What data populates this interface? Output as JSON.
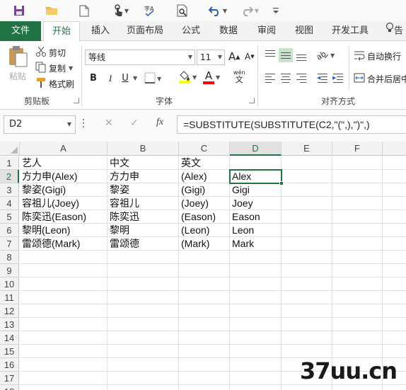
{
  "qat": {
    "icons": [
      "save-icon",
      "open-folder-icon",
      "new-file-icon",
      "touch-mode-icon",
      "spelling-icon",
      "print-preview-icon",
      "undo-icon",
      "redo-icon",
      "customize-qat-icon"
    ]
  },
  "tabs": [
    {
      "label": "文件"
    },
    {
      "label": "开始"
    },
    {
      "label": "插入"
    },
    {
      "label": "页面布局"
    },
    {
      "label": "公式"
    },
    {
      "label": "数据"
    },
    {
      "label": "审阅"
    },
    {
      "label": "视图"
    },
    {
      "label": "开发工具"
    },
    {
      "label": "告"
    }
  ],
  "ribbon": {
    "clipboard": {
      "paste_label": "粘贴",
      "cut_label": "剪切",
      "copy_label": "复制",
      "format_painter_label": "格式刷",
      "group_label": "剪贴板"
    },
    "font": {
      "font_name": "等线",
      "font_size": "11",
      "bold": "B",
      "italic": "I",
      "underline": "U",
      "grow": "A",
      "shrink": "A",
      "wen": "wén",
      "wen_char": "文",
      "group_label": "字体",
      "fill_color": "#ffff00",
      "font_color": "#ff0000"
    },
    "alignment": {
      "wrap_text_label": "自动换行",
      "merge_label": "合并后居中",
      "group_label": "对齐方式"
    }
  },
  "formula_bar": {
    "name_box": "D2",
    "cancel": "✕",
    "enter": "✓",
    "fx": "fx",
    "formula": "=SUBSTITUTE(SUBSTITUTE(C2,\"(\",),\")\",)"
  },
  "sheet": {
    "columns": [
      "A",
      "B",
      "C",
      "D",
      "E",
      "F"
    ],
    "rows": [
      "1",
      "2",
      "3",
      "4",
      "5",
      "6",
      "7",
      "8",
      "9",
      "10",
      "11",
      "12",
      "13",
      "14",
      "15",
      "16",
      "17",
      "18"
    ],
    "cells": [
      [
        "艺人",
        "中文",
        "英文",
        ""
      ],
      [
        "方力申(Alex)",
        "方力申",
        "(Alex)",
        "Alex"
      ],
      [
        "黎姿(Gigi)",
        "黎姿",
        "(Gigi)",
        "Gigi"
      ],
      [
        "容祖儿(Joey)",
        "容祖儿",
        "(Joey)",
        "Joey"
      ],
      [
        "陈奕迅(Eason)",
        "陈奕迅",
        "(Eason)",
        "Eason"
      ],
      [
        "黎明(Leon)",
        "黎明",
        "(Leon)",
        "Leon"
      ],
      [
        "雷颂德(Mark)",
        "雷颂德",
        "(Mark)",
        "Mark"
      ]
    ],
    "active_cell": "D2",
    "accent_color": "#217346"
  },
  "watermark": "37uu.cn"
}
